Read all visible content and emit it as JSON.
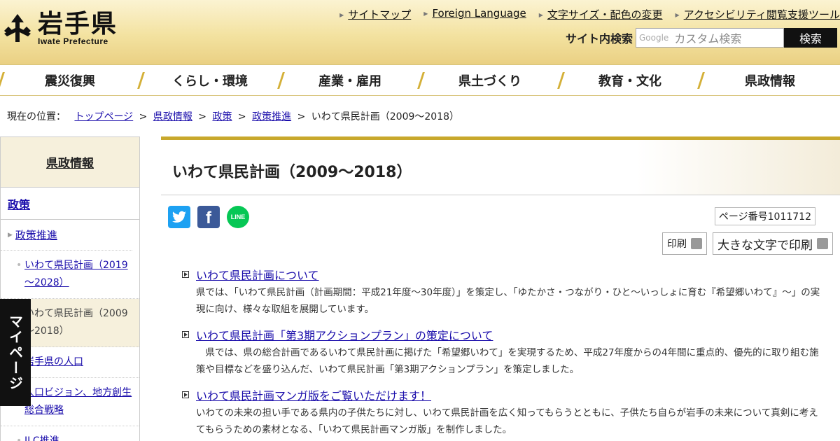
{
  "header": {
    "logo_title": "岩手県",
    "logo_sub": "Iwate Prefecture",
    "top_links": [
      "サイトマップ",
      "Foreign Language",
      "文字サイズ・配色の変更",
      "アクセシビリティ閲覧支援ツール"
    ],
    "search_label": "サイト内検索",
    "search_google": "Google",
    "search_placeholder": "カスタム検索",
    "search_button": "検索"
  },
  "gnav": [
    "震災復興",
    "くらし・環境",
    "産業・雇用",
    "県土づくり",
    "教育・文化",
    "県政情報"
  ],
  "breadcrumb": {
    "prefix": "現在の位置：",
    "links": [
      "トップページ",
      "県政情報",
      "政策",
      "政策推進"
    ],
    "current": "いわて県民計画（2009～2018）"
  },
  "sidebar": {
    "head": "県政情報",
    "section": "政策",
    "sub": "政策推進",
    "items": [
      "いわて県民計画（2019～2028）",
      "いわて県民計画（2009～2018）",
      "岩手県の人口",
      "人口ビジョン、地方創生総合戦略",
      "ILC推進"
    ]
  },
  "mypage": "マイページ",
  "main": {
    "title": "いわて県民計画（2009～2018）",
    "page_number": "ページ番号1011712",
    "print_label": "印刷",
    "print_big_label": "大きな文字で印刷",
    "share": [
      "twitter",
      "facebook",
      "line"
    ],
    "articles": [
      {
        "link": "いわて県民計画について",
        "desc": "県では、「いわて県民計画（計画期間：平成21年度～30年度）」を策定し、「ゆたかさ・つながり・ひと～いっしょに育む『希望郷いわて』～」の実現に向け、様々な取組を展開しています。"
      },
      {
        "link": "いわて県民計画「第3期アクションプラン」の策定について",
        "desc": "　県では、県の総合計画であるいわて県民計画に掲げた「希望郷いわて」を実現するため、平成27年度からの4年間に重点的、優先的に取り組む施策や目標などを盛り込んだ、いわて県民計画「第3期アクションプラン」を策定しました。"
      },
      {
        "link": "いわて県民計画マンガ版をご覧いただけます！",
        "desc": "いわての未来の担い手である県内の子供たちに対し、いわて県民計画を広く知ってもらうとともに、子供たち自らが岩手の未来について真剣に考えてもらうための素材となる、「いわて県民計画マンガ版」を制作しました。"
      }
    ]
  },
  "colors": {
    "gold": "#c8a82c",
    "twitter": "#1da1f2",
    "facebook": "#3b5998",
    "line": "#06c755"
  }
}
